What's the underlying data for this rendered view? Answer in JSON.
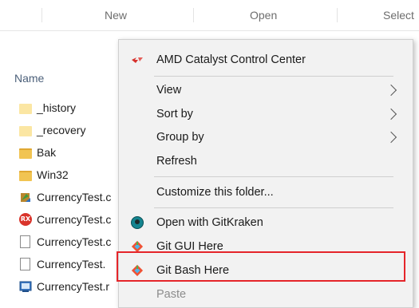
{
  "ribbon": {
    "groups": [
      "New",
      "Open",
      "Select"
    ]
  },
  "file_list": {
    "column_header": "Name",
    "items": [
      {
        "name": "_history",
        "icon": "folder-light-icon"
      },
      {
        "name": "_recovery",
        "icon": "folder-light-icon"
      },
      {
        "name": "Bak",
        "icon": "folder-icon"
      },
      {
        "name": "Win32",
        "icon": "folder-icon"
      },
      {
        "name": "CurrencyTest.c",
        "icon": "dll-file-icon"
      },
      {
        "name": "CurrencyTest.c",
        "icon": "rx-file-icon"
      },
      {
        "name": "CurrencyTest.c",
        "icon": "document-icon"
      },
      {
        "name": "CurrencyTest.",
        "icon": "document-icon"
      },
      {
        "name": "CurrencyTest.r",
        "icon": "project-file-icon"
      }
    ]
  },
  "context_menu": {
    "items": [
      {
        "label": "AMD Catalyst Control Center",
        "icon": "amd-icon"
      },
      {
        "label": "View",
        "submenu": true
      },
      {
        "label": "Sort by",
        "submenu": true
      },
      {
        "label": "Group by",
        "submenu": true
      },
      {
        "label": "Refresh"
      },
      {
        "label": "Customize this folder..."
      },
      {
        "label": "Open with GitKraken",
        "icon": "gitkraken-icon"
      },
      {
        "label": "Git GUI Here",
        "icon": "git-icon"
      },
      {
        "label": "Git Bash Here",
        "icon": "git-icon",
        "highlighted": true
      },
      {
        "label": "Paste",
        "disabled": true
      }
    ],
    "highlight_color": "#e5252a"
  }
}
